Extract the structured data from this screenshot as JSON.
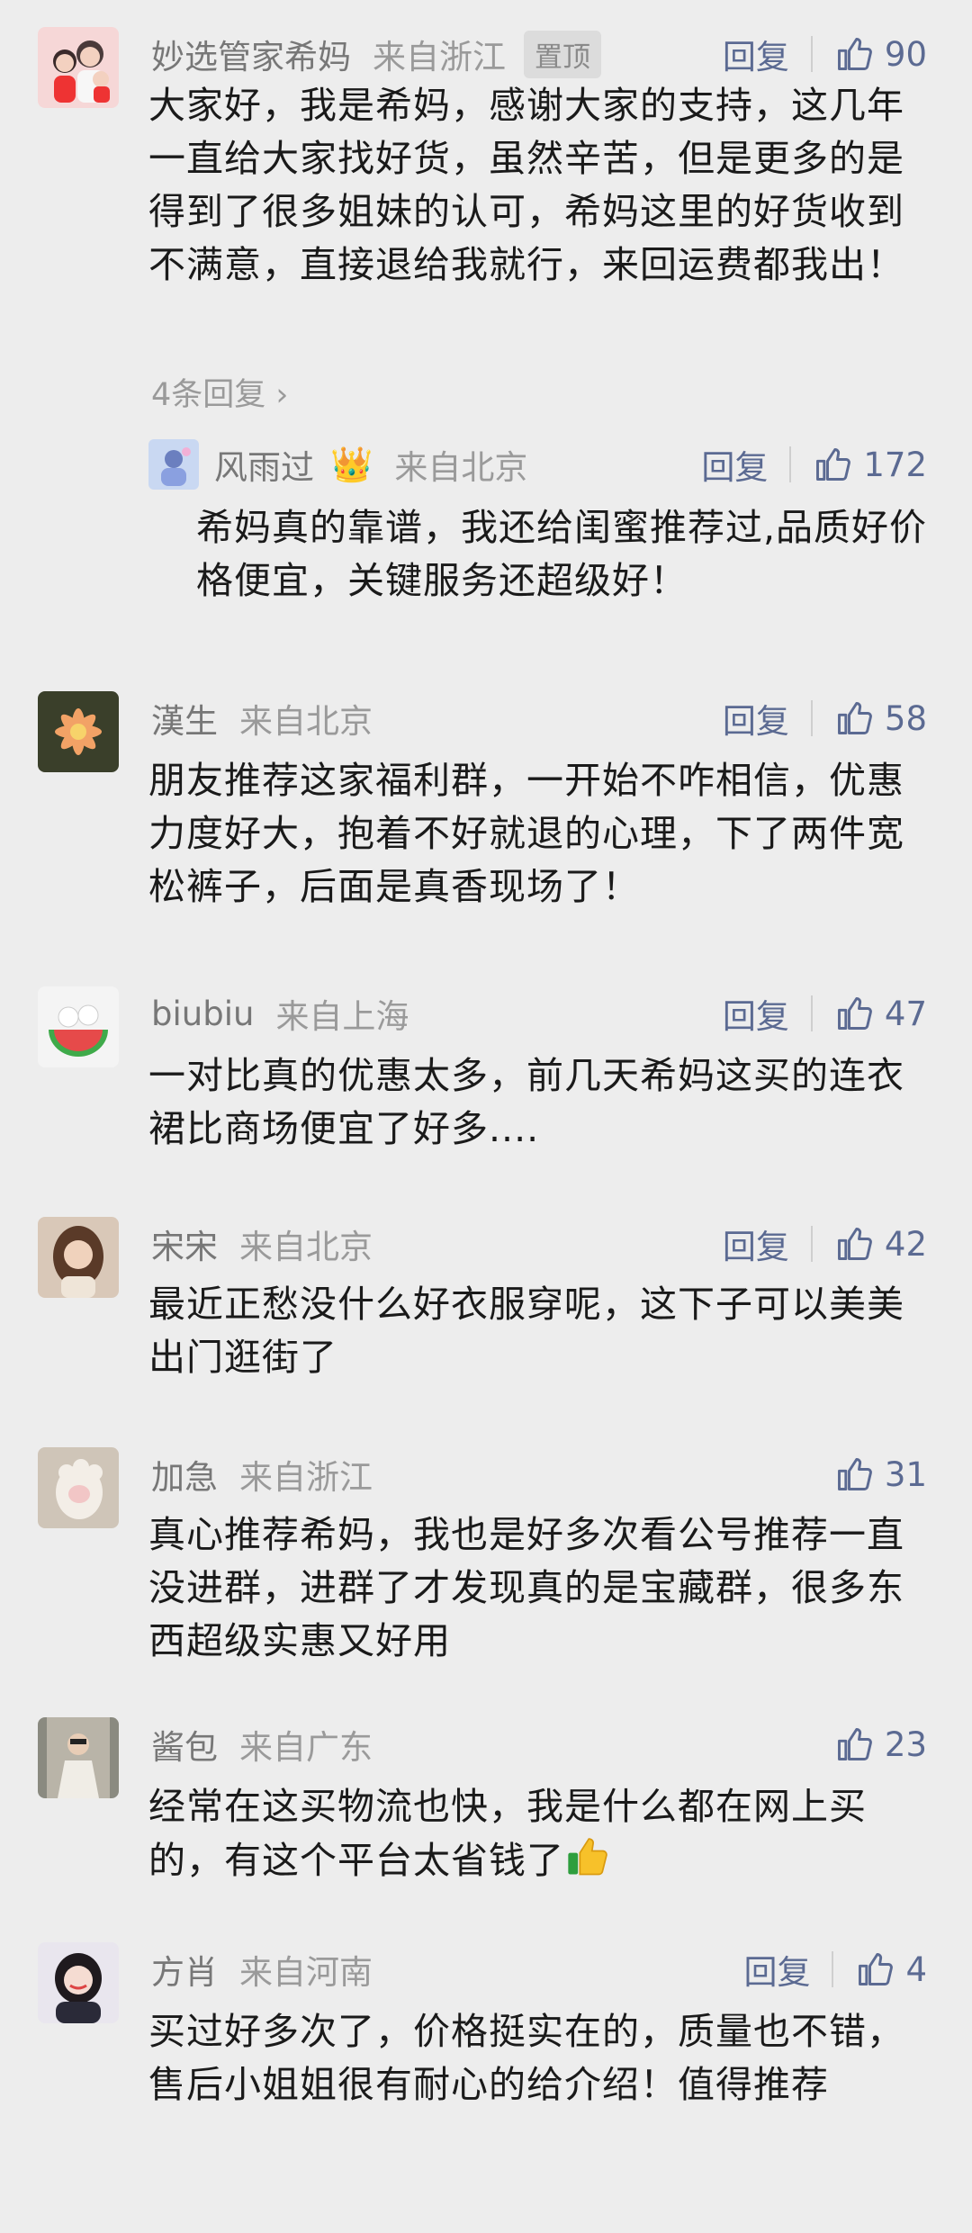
{
  "comments": [
    {
      "name": "妙选管家希妈",
      "location": "来自浙江",
      "pinned": "置顶",
      "reply": "回复",
      "likes": "90",
      "text": "大家好，我是希妈，感谢大家的支持，这几年一直给大家找好货，虽然辛苦，但是更多的是得到了很多姐妹的认可，希妈这里的好货收到不满意，直接退给我就行，来回运费都我出！",
      "more_replies": "4条回复",
      "sub_reply": {
        "name": "风雨过",
        "location": "来自北京",
        "reply": "回复",
        "likes": "172",
        "text": "希妈真的靠谱，我还给闺蜜推荐过,品质好价格便宜，关键服务还超级好！"
      }
    },
    {
      "name": "漢生",
      "location": "来自北京",
      "reply": "回复",
      "likes": "58",
      "text": "朋友推荐这家福利群，一开始不咋相信，优惠力度好大，抱着不好就退的心理，下了两件宽松裤子，后面是真香现场了！"
    },
    {
      "name": "biubiu",
      "location": "来自上海",
      "reply": "回复",
      "likes": "47",
      "text": "一对比真的优惠太多，前几天希妈这买的连衣裙比商场便宜了好多...."
    },
    {
      "name": "宋宋",
      "location": "来自北京",
      "reply": "回复",
      "likes": "42",
      "text": "最近正愁没什么好衣服穿呢，这下子可以美美出门逛街了"
    },
    {
      "name": "加急",
      "location": "来自浙江",
      "likes": "31",
      "text": "真心推荐希妈，我也是好多次看公号推荐一直没进群，进群了才发现真的是宝藏群，很多东西超级实惠又好用"
    },
    {
      "name": "酱包",
      "location": "来自广东",
      "likes": "23",
      "text": "经常在这买物流也快，我是什么都在网上买的，有这个平台太省钱了"
    },
    {
      "name": "方肖",
      "location": "来自河南",
      "reply": "回复",
      "likes": "4",
      "text": "买过好多次了，价格挺实在的，质量也不错，售后小姐姐很有耐心的给介绍！值得推荐"
    }
  ]
}
